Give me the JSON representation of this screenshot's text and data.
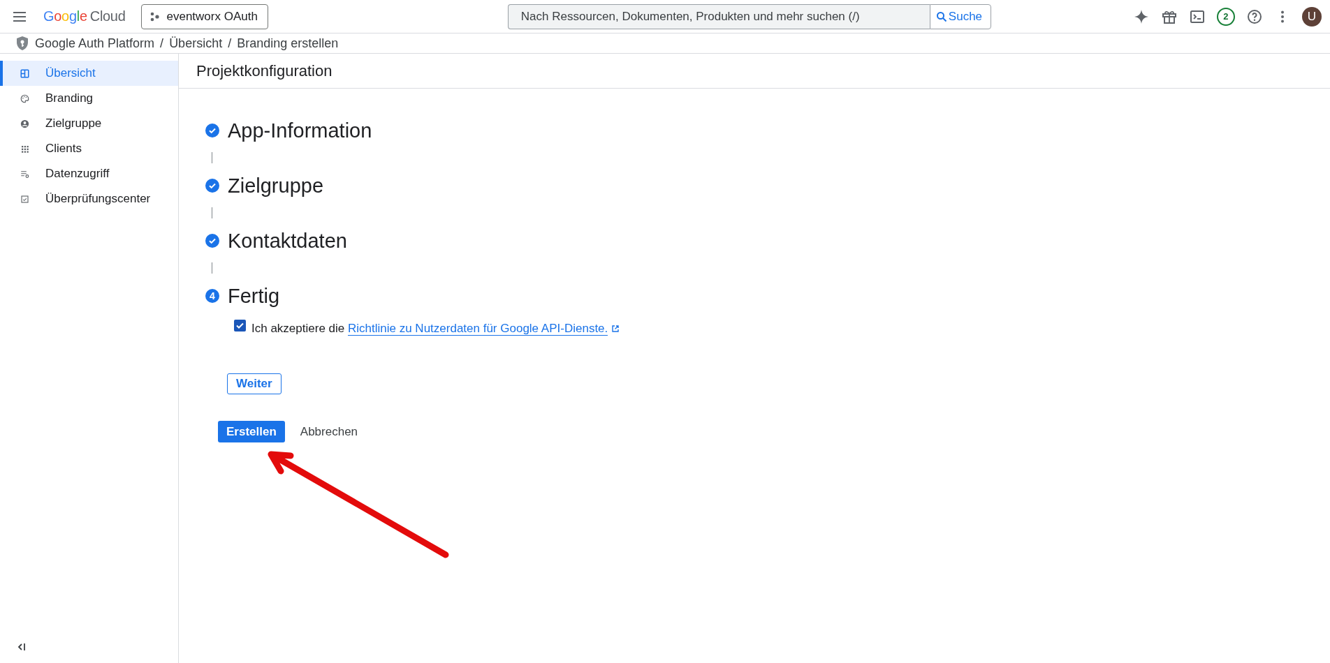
{
  "header": {
    "logo_brand": "Google",
    "logo_product": "Cloud",
    "project": "eventworx OAuth",
    "search": {
      "placeholder": "Nach Ressourcen, Dokumenten, Produkten und mehr suchen (/)",
      "button": "Suche"
    },
    "notification_count": "2",
    "avatar_letter": "U"
  },
  "breadcrumb": [
    {
      "label": "Google Auth Platform"
    },
    {
      "separator": "/",
      "label": "Übersicht"
    },
    {
      "separator": "/",
      "label": "Branding erstellen"
    }
  ],
  "sidebar": {
    "items": [
      {
        "label": "Übersicht",
        "selected": true
      },
      {
        "label": "Branding",
        "selected": false
      },
      {
        "label": "Zielgruppe",
        "selected": false
      },
      {
        "label": "Clients",
        "selected": false
      },
      {
        "label": "Datenzugriff",
        "selected": false
      },
      {
        "label": "Überprüfungscenter",
        "selected": false
      }
    ]
  },
  "page_title": "Projektkonfiguration",
  "steps": [
    {
      "title": "App-Information",
      "done": true
    },
    {
      "title": "Zielgruppe",
      "done": true
    },
    {
      "title": "Kontaktdaten",
      "done": true
    },
    {
      "title": "Fertig",
      "done": false,
      "number": "4"
    }
  ],
  "consent": {
    "checked": true,
    "text": "Ich akzeptiere die",
    "link": "Richtlinie zu Nutzerdaten für Google API-Dienste."
  },
  "next_button": "Weiter",
  "buttons": [
    {
      "label": "Erstellen",
      "kind": "primary"
    },
    {
      "label": "Abbrechen",
      "kind": "text"
    }
  ]
}
